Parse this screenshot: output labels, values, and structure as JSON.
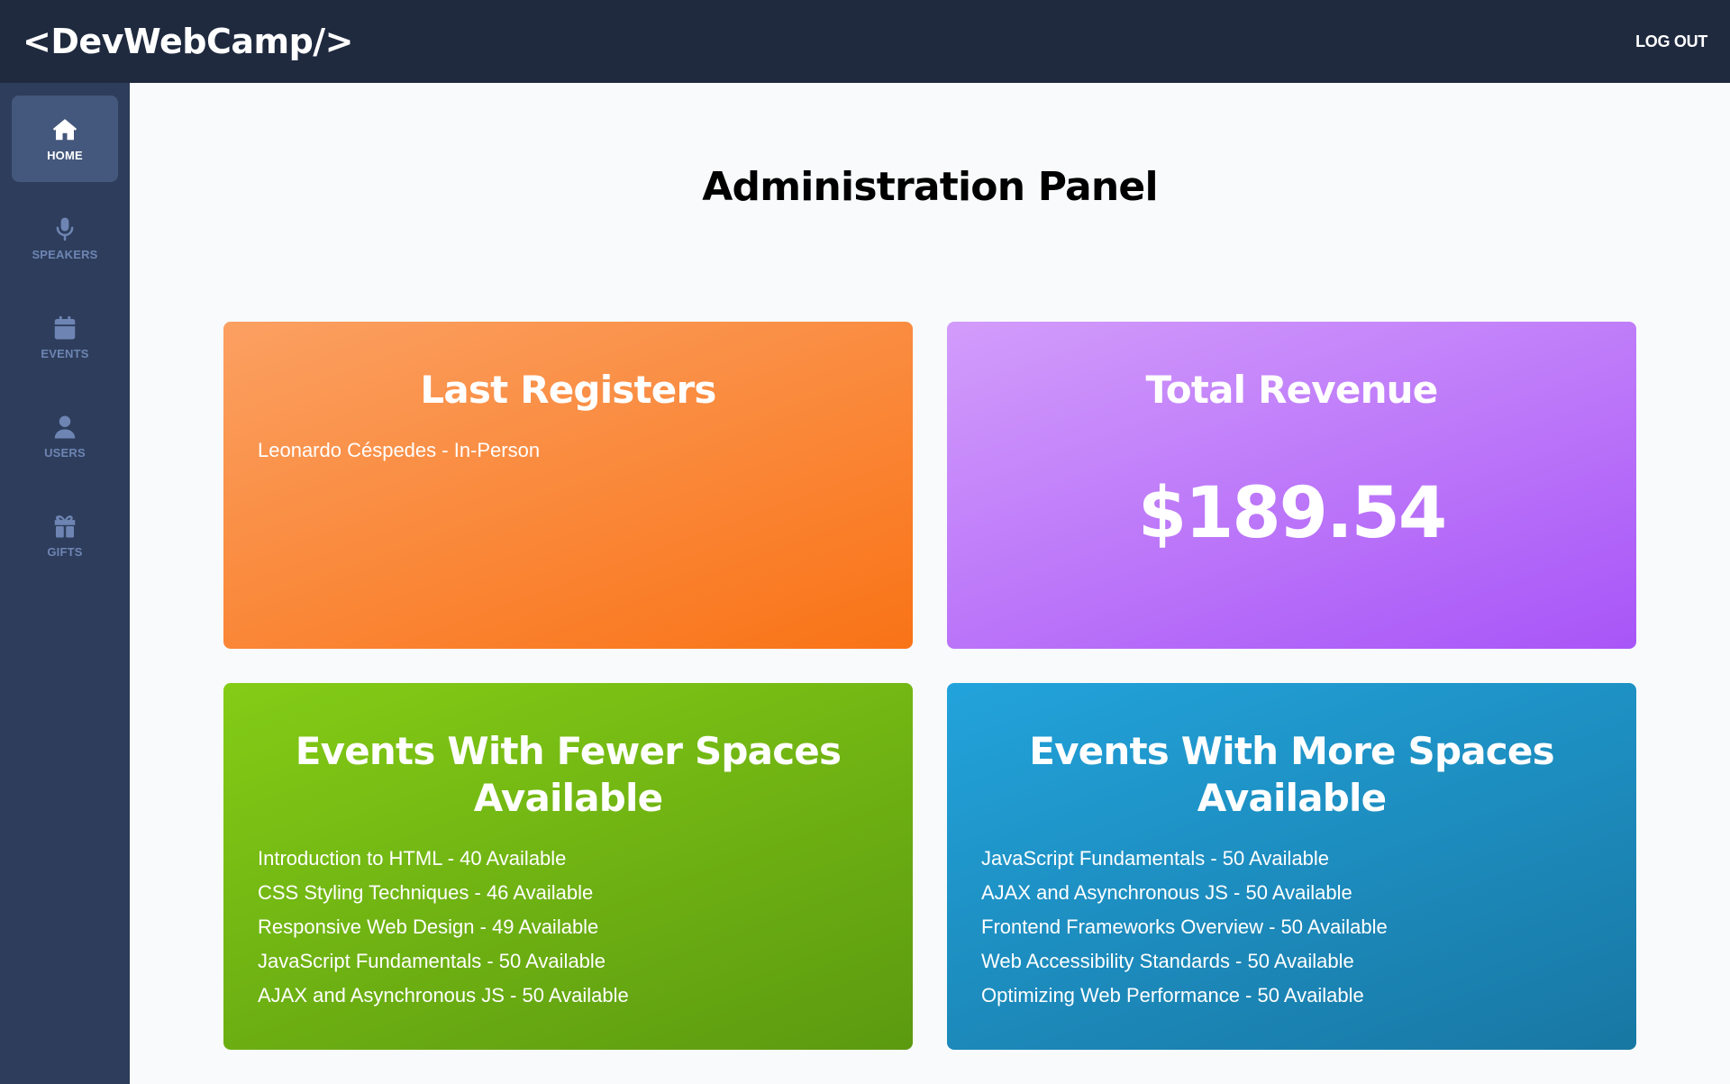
{
  "header": {
    "logo": "<DevWebCamp/>",
    "logout_label": "LOG OUT"
  },
  "sidebar": {
    "items": [
      {
        "label": "HOME",
        "icon": "home-icon",
        "active": true
      },
      {
        "label": "SPEAKERS",
        "icon": "microphone-icon",
        "active": false
      },
      {
        "label": "EVENTS",
        "icon": "calendar-icon",
        "active": false
      },
      {
        "label": "USERS",
        "icon": "user-icon",
        "active": false
      },
      {
        "label": "GIFTS",
        "icon": "gift-icon",
        "active": false
      }
    ]
  },
  "main": {
    "title": "Administration Panel",
    "last_registers": {
      "title": "Last Registers",
      "items": [
        "Leonardo Céspedes - In-Person"
      ]
    },
    "total_revenue": {
      "title": "Total Revenue",
      "amount": "$189.54"
    },
    "fewer_spaces": {
      "title": "Events With Fewer Spaces Available",
      "items": [
        "Introduction to HTML - 40 Available",
        "CSS Styling Techniques - 46 Available",
        "Responsive Web Design - 49 Available",
        "JavaScript Fundamentals - 50 Available",
        "AJAX and Asynchronous JS - 50 Available"
      ]
    },
    "more_spaces": {
      "title": "Events With More Spaces Available",
      "items": [
        "JavaScript Fundamentals - 50 Available",
        "AJAX and Asynchronous JS - 50 Available",
        "Frontend Frameworks Overview - 50 Available",
        "Web Accessibility Standards - 50 Available",
        "Optimizing Web Performance - 50 Available"
      ]
    }
  },
  "colors": {
    "header_bg": "#1f2a3f",
    "sidebar_bg": "#2d3d5b",
    "sidebar_active": "#44577c",
    "orange": "#f97316",
    "purple": "#a855f7",
    "green": "#84cc16",
    "blue": "#22a3db"
  }
}
